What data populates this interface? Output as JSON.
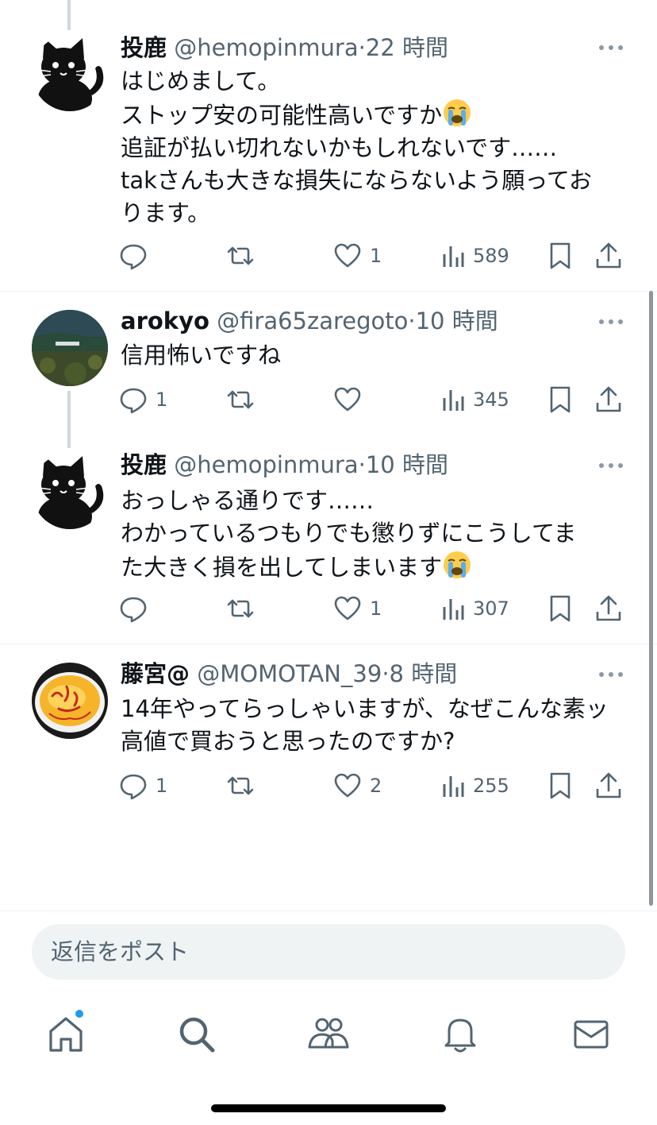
{
  "tweets": [
    {
      "name": "投鹿",
      "handle": "@hemopinmura",
      "time": "22 時間",
      "lines": [
        "はじめまして。",
        "ストップ安の可能性高いですか",
        "追証が払い切れないかもしれないです……",
        "takさんも大きな損失にならないよう願ってお",
        "ります。"
      ],
      "emoji_line": 1,
      "replies": "",
      "likes": "1",
      "views": "589",
      "avatar": "black-cat"
    },
    {
      "name": "arokyo",
      "handle": "@fira65zaregoto",
      "time": "10 時間",
      "lines": [
        "信用怖いですね"
      ],
      "emoji_line": -1,
      "replies": "1",
      "likes": "",
      "views": "345",
      "avatar": "landscape-photo"
    },
    {
      "name": "投鹿",
      "handle": "@hemopinmura",
      "time": "10 時間",
      "lines": [
        "おっしゃる通りです……",
        "わかっているつもりでも懲りずにこうしてま",
        "た大きく損を出してしまいます"
      ],
      "emoji_line": 2,
      "replies": "",
      "likes": "1",
      "views": "307",
      "avatar": "black-cat"
    },
    {
      "name": "藤宮@",
      "handle": "@MOMOTAN_39",
      "time": "8 時間",
      "lines": [
        "14年やってらっしゃいますが、なぜこんな素ッ",
        "高値で買おうと思ったのですか?"
      ],
      "emoji_line": -1,
      "replies": "1",
      "likes": "2",
      "views": "255",
      "avatar": "omurice-photo"
    }
  ],
  "reply_box": {
    "placeholder": "返信をポスト"
  },
  "nav": [
    "home-icon",
    "search-icon",
    "communities-icon",
    "notifications-icon",
    "messages-icon"
  ],
  "colors": {
    "accent": "#1d9bf0",
    "secondary_text": "#536471",
    "primary_text": "#0f1419"
  }
}
